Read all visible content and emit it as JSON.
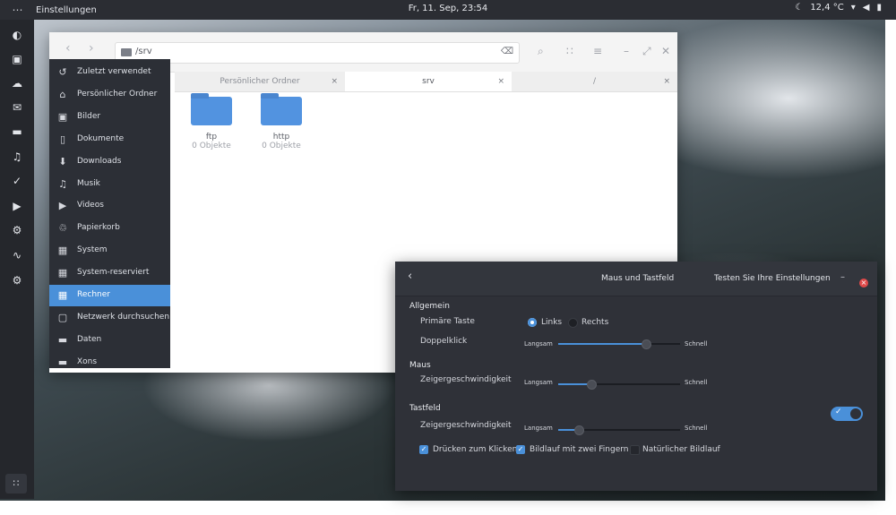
{
  "topbar": {
    "apps_glyph": "⋯",
    "app_name": "Einstellungen",
    "clock": "Fr, 11. Sep, 23:54",
    "weather_icon": "☾",
    "temperature": "12,4 °C",
    "wifi_icon": "▾",
    "volume_icon": "◀",
    "battery_icon": "▮"
  },
  "dock": {
    "icons": [
      "◐",
      "▣",
      "☁",
      "✉",
      "▬",
      "♫",
      "✓",
      "▶",
      "⚙",
      "∿",
      "⚙"
    ],
    "grid_glyph": "∷"
  },
  "files": {
    "back": "‹",
    "forward": "›",
    "path": "/srv",
    "clear": "⌫",
    "toolbar": [
      "⌕",
      "∷",
      "≡"
    ],
    "window_controls": [
      "–",
      "⤢",
      "✕"
    ],
    "sidebar": [
      {
        "icon": "↺",
        "label": "Zuletzt verwendet"
      },
      {
        "icon": "⌂",
        "label": "Persönlicher Ordner"
      },
      {
        "icon": "▣",
        "label": "Bilder"
      },
      {
        "icon": "▯",
        "label": "Dokumente"
      },
      {
        "icon": "⬇",
        "label": "Downloads"
      },
      {
        "icon": "♫",
        "label": "Musik"
      },
      {
        "icon": "▶",
        "label": "Videos"
      },
      {
        "icon": "♲",
        "label": "Papierkorb"
      },
      {
        "icon": "▦",
        "label": "System"
      },
      {
        "icon": "▦",
        "label": "System-reserviert"
      },
      {
        "icon": "▦",
        "label": "Rechner"
      },
      {
        "icon": "▢",
        "label": "Netzwerk durchsuchen"
      },
      {
        "icon": "▬",
        "label": "Daten"
      },
      {
        "icon": "▬",
        "label": "Xons"
      }
    ],
    "active_index": 10,
    "tabs": [
      {
        "label": "Persönlicher Ordner",
        "close": "×"
      },
      {
        "label": "srv",
        "close": "×"
      },
      {
        "label": "/",
        "close": "×"
      }
    ],
    "items": [
      {
        "name": "ftp",
        "count": "0 Objekte"
      },
      {
        "name": "http",
        "count": "0 Objekte"
      }
    ]
  },
  "settings": {
    "back": "‹",
    "title": "Maus und Tastfeld",
    "test_label": "Testen Sie Ihre Einstellungen",
    "minimize": "–",
    "close": "×",
    "general": {
      "heading": "Allgemein",
      "primary_key_label": "Primäre Taste",
      "left_option": "Links",
      "right_option": "Rechts",
      "double_click_label": "Doppelklick",
      "double_click_value": 0.72
    },
    "mouse": {
      "heading": "Maus",
      "speed_label": "Zeigergeschwindigkeit",
      "speed_value": 0.27
    },
    "touchpad": {
      "heading": "Tastfeld",
      "speed_label": "Zeigergeschwindigkeit",
      "speed_value": 0.17,
      "toggle_check": "✓",
      "tap_to_click": "Drücken zum Klicken",
      "two_finger_scroll": "Bildlauf mit zwei Fingern",
      "natural_scroll": "Natürlicher Bildlauf",
      "check_glyph": "✓"
    },
    "slow_label": "Langsam",
    "fast_label": "Schnell"
  }
}
